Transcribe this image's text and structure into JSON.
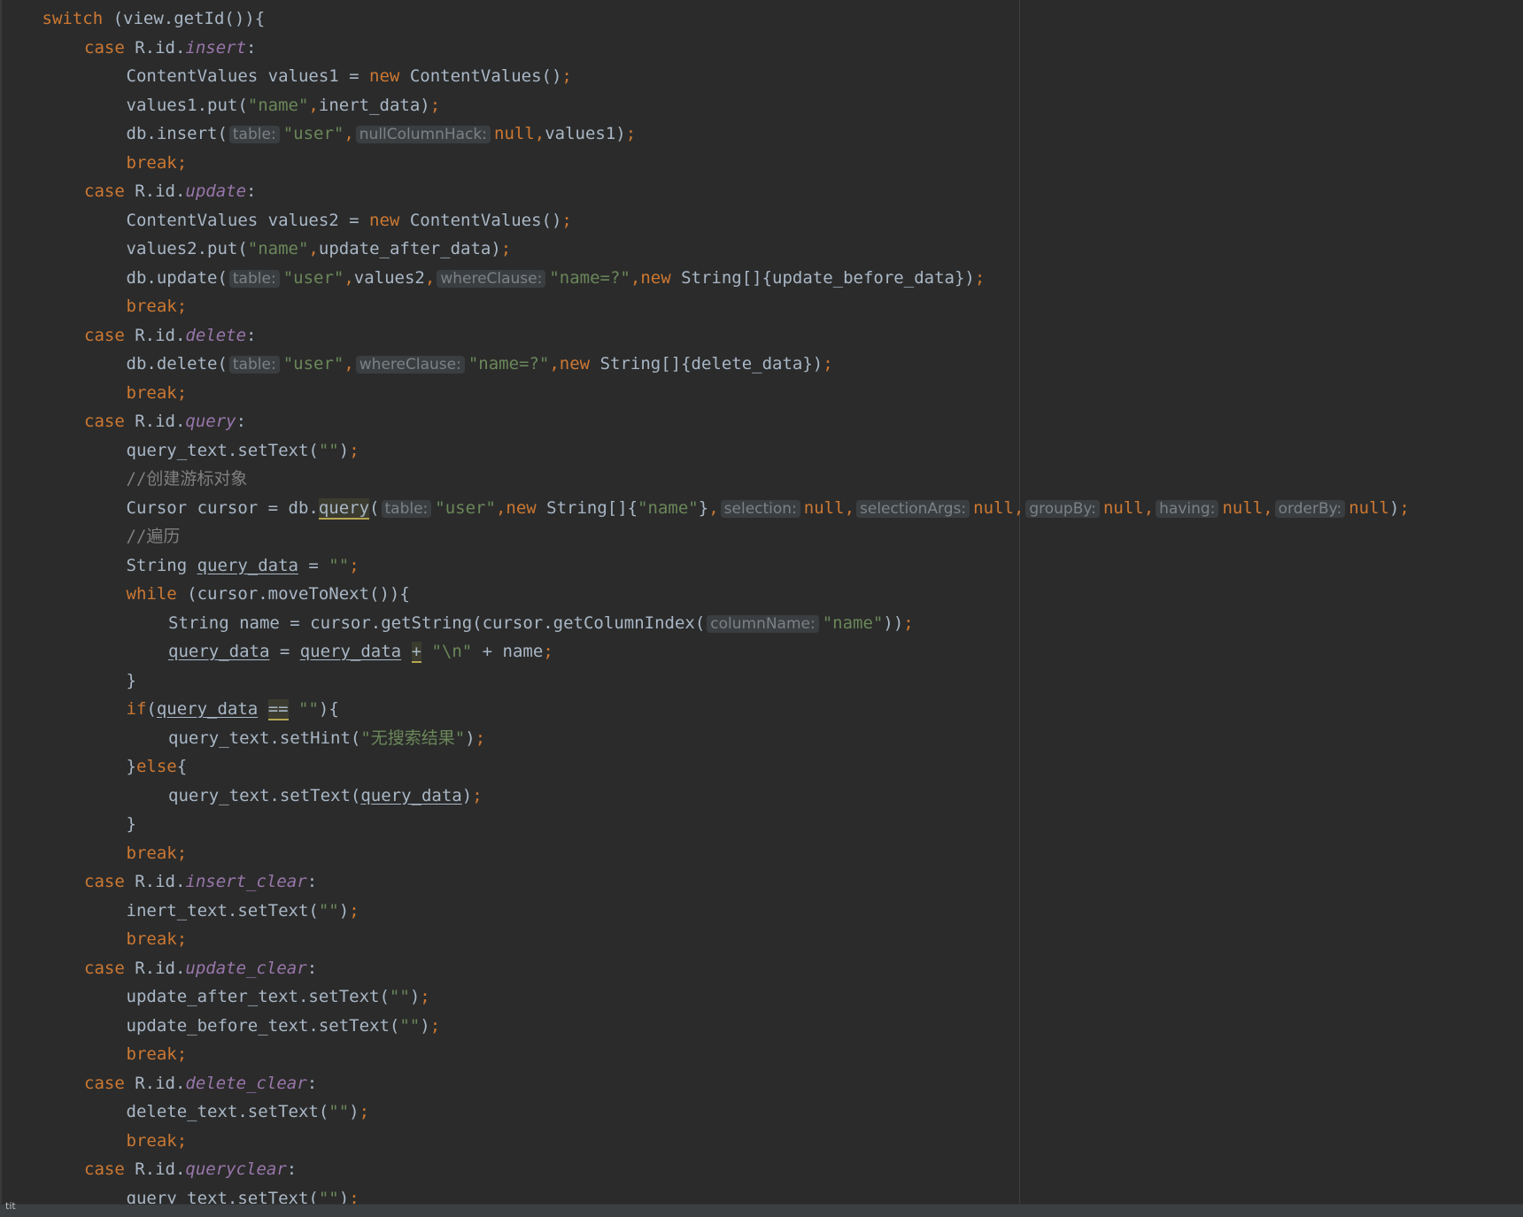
{
  "editor": {
    "language": "java",
    "theme_colors": {
      "background": "#2b2b2b",
      "default_text": "#a9b7c6",
      "keyword": "#cc7832",
      "string": "#6a8759",
      "field": "#9876aa",
      "comment": "#808080",
      "param_hint_bg": "#3b3e40",
      "param_hint_text": "#7b8186"
    },
    "lines": [
      {
        "indent": 1,
        "tokens": [
          {
            "t": "switch",
            "c": "kw"
          },
          {
            "t": " (view.getId()){"
          }
        ]
      },
      {
        "indent": 2,
        "tokens": [
          {
            "t": "case ",
            "c": "kw"
          },
          {
            "t": "R.id."
          },
          {
            "t": "insert",
            "c": "field"
          },
          {
            "t": ":"
          }
        ]
      },
      {
        "indent": 3,
        "tokens": [
          {
            "t": "ContentValues values1 = "
          },
          {
            "t": "new ",
            "c": "kw"
          },
          {
            "t": "ContentValues()"
          },
          {
            "t": ";",
            "c": "kw"
          }
        ]
      },
      {
        "indent": 3,
        "tokens": [
          {
            "t": "values1.put("
          },
          {
            "t": "\"name\"",
            "c": "str"
          },
          {
            "t": ",",
            "c": "kw"
          },
          {
            "t": "inert_data)"
          },
          {
            "t": ";",
            "c": "kw"
          }
        ]
      },
      {
        "indent": 3,
        "tokens": [
          {
            "t": "db.insert("
          },
          {
            "t": "table:",
            "c": "hint"
          },
          {
            "t": "\"user\"",
            "c": "str"
          },
          {
            "t": ",",
            "c": "kw"
          },
          {
            "t": "nullColumnHack:",
            "c": "hint"
          },
          {
            "t": "null",
            "c": "kw"
          },
          {
            "t": ",",
            "c": "kw"
          },
          {
            "t": "values1)"
          },
          {
            "t": ";",
            "c": "kw"
          }
        ]
      },
      {
        "indent": 3,
        "tokens": [
          {
            "t": "break;",
            "c": "kw"
          }
        ]
      },
      {
        "indent": 2,
        "tokens": [
          {
            "t": "case ",
            "c": "kw"
          },
          {
            "t": "R.id."
          },
          {
            "t": "update",
            "c": "field"
          },
          {
            "t": ":"
          }
        ]
      },
      {
        "indent": 3,
        "tokens": [
          {
            "t": "ContentValues values2 = "
          },
          {
            "t": "new ",
            "c": "kw"
          },
          {
            "t": "ContentValues()"
          },
          {
            "t": ";",
            "c": "kw"
          }
        ]
      },
      {
        "indent": 3,
        "tokens": [
          {
            "t": "values2.put("
          },
          {
            "t": "\"name\"",
            "c": "str"
          },
          {
            "t": ",",
            "c": "kw"
          },
          {
            "t": "update_after_data)"
          },
          {
            "t": ";",
            "c": "kw"
          }
        ]
      },
      {
        "indent": 3,
        "tokens": [
          {
            "t": "db.update("
          },
          {
            "t": "table:",
            "c": "hint"
          },
          {
            "t": "\"user\"",
            "c": "str"
          },
          {
            "t": ",",
            "c": "kw"
          },
          {
            "t": "values2"
          },
          {
            "t": ",",
            "c": "kw"
          },
          {
            "t": "whereClause:",
            "c": "hint"
          },
          {
            "t": "\"name=?\"",
            "c": "str"
          },
          {
            "t": ",",
            "c": "kw"
          },
          {
            "t": "new ",
            "c": "kw"
          },
          {
            "t": "String[]{update_before_data})"
          },
          {
            "t": ";",
            "c": "kw"
          }
        ]
      },
      {
        "indent": 3,
        "tokens": [
          {
            "t": "break;",
            "c": "kw"
          }
        ]
      },
      {
        "indent": 2,
        "tokens": [
          {
            "t": "case ",
            "c": "kw"
          },
          {
            "t": "R.id."
          },
          {
            "t": "delete",
            "c": "field"
          },
          {
            "t": ":"
          }
        ]
      },
      {
        "indent": 3,
        "tokens": [
          {
            "t": "db.delete("
          },
          {
            "t": "table:",
            "c": "hint"
          },
          {
            "t": "\"user\"",
            "c": "str"
          },
          {
            "t": ",",
            "c": "kw"
          },
          {
            "t": "whereClause:",
            "c": "hint"
          },
          {
            "t": "\"name=?\"",
            "c": "str"
          },
          {
            "t": ",",
            "c": "kw"
          },
          {
            "t": "new ",
            "c": "kw"
          },
          {
            "t": "String[]{delete_data})"
          },
          {
            "t": ";",
            "c": "kw"
          }
        ]
      },
      {
        "indent": 3,
        "tokens": [
          {
            "t": "break;",
            "c": "kw"
          }
        ]
      },
      {
        "indent": 2,
        "tokens": [
          {
            "t": "case ",
            "c": "kw"
          },
          {
            "t": "R.id."
          },
          {
            "t": "query",
            "c": "field"
          },
          {
            "t": ":"
          }
        ]
      },
      {
        "indent": 3,
        "tokens": [
          {
            "t": "query_text.setText("
          },
          {
            "t": "\"\"",
            "c": "str"
          },
          {
            "t": ")"
          },
          {
            "t": ";",
            "c": "kw"
          }
        ]
      },
      {
        "indent": 3,
        "tokens": [
          {
            "t": "//创建游标对象",
            "c": "cmt"
          }
        ]
      },
      {
        "indent": 3,
        "tokens": [
          {
            "t": "Cursor cursor = db."
          },
          {
            "t": "query",
            "c": "hl"
          },
          {
            "t": "("
          },
          {
            "t": "table:",
            "c": "hint"
          },
          {
            "t": "\"user\"",
            "c": "str"
          },
          {
            "t": ",",
            "c": "kw"
          },
          {
            "t": "new ",
            "c": "kw"
          },
          {
            "t": "String[]{"
          },
          {
            "t": "\"name\"",
            "c": "str"
          },
          {
            "t": "}"
          },
          {
            "t": ",",
            "c": "kw"
          },
          {
            "t": "selection:",
            "c": "hint"
          },
          {
            "t": "null",
            "c": "kw"
          },
          {
            "t": ",",
            "c": "kw"
          },
          {
            "t": "selectionArgs:",
            "c": "hint"
          },
          {
            "t": "null",
            "c": "kw"
          },
          {
            "t": ",",
            "c": "kw"
          },
          {
            "t": "groupBy:",
            "c": "hint"
          },
          {
            "t": "null",
            "c": "kw"
          },
          {
            "t": ",",
            "c": "kw"
          },
          {
            "t": "having:",
            "c": "hint"
          },
          {
            "t": "null",
            "c": "kw"
          },
          {
            "t": ",",
            "c": "kw"
          },
          {
            "t": "orderBy:",
            "c": "hint"
          },
          {
            "t": "null",
            "c": "kw"
          },
          {
            "t": ")"
          },
          {
            "t": ";",
            "c": "kw"
          }
        ]
      },
      {
        "indent": 3,
        "tokens": [
          {
            "t": "//遍历",
            "c": "cmt"
          }
        ]
      },
      {
        "indent": 3,
        "tokens": [
          {
            "t": "String "
          },
          {
            "t": "query_data",
            "c": "u"
          },
          {
            "t": " = "
          },
          {
            "t": "\"\"",
            "c": "str"
          },
          {
            "t": ";",
            "c": "kw"
          }
        ]
      },
      {
        "indent": 3,
        "tokens": [
          {
            "t": "while ",
            "c": "kw"
          },
          {
            "t": "(cursor.moveToNext()){"
          }
        ]
      },
      {
        "indent": 4,
        "tokens": [
          {
            "t": "String name = cursor.getString(cursor.getColumnIndex("
          },
          {
            "t": "columnName:",
            "c": "hint"
          },
          {
            "t": "\"name\"",
            "c": "str"
          },
          {
            "t": "))"
          },
          {
            "t": ";",
            "c": "kw"
          }
        ]
      },
      {
        "indent": 4,
        "tokens": [
          {
            "t": "query_data",
            "c": "u"
          },
          {
            "t": " = "
          },
          {
            "t": "query_data",
            "c": "u"
          },
          {
            "t": " "
          },
          {
            "t": "+",
            "c": "hl"
          },
          {
            "t": " "
          },
          {
            "t": "\"\\n\"",
            "c": "str"
          },
          {
            "t": " + name"
          },
          {
            "t": ";",
            "c": "kw"
          }
        ]
      },
      {
        "indent": 3,
        "tokens": [
          {
            "t": "}"
          }
        ]
      },
      {
        "indent": 3,
        "tokens": [
          {
            "t": "if",
            "c": "kw"
          },
          {
            "t": "("
          },
          {
            "t": "query_data",
            "c": "u"
          },
          {
            "t": " "
          },
          {
            "t": "==",
            "c": "hl"
          },
          {
            "t": " "
          },
          {
            "t": "\"\"",
            "c": "str"
          },
          {
            "t": "){"
          }
        ]
      },
      {
        "indent": 4,
        "tokens": [
          {
            "t": "query_text.setHint("
          },
          {
            "t": "\"无搜索结果\"",
            "c": "str"
          },
          {
            "t": ")"
          },
          {
            "t": ";",
            "c": "kw"
          }
        ]
      },
      {
        "indent": 3,
        "tokens": [
          {
            "t": "}"
          },
          {
            "t": "else",
            "c": "kw"
          },
          {
            "t": "{"
          }
        ]
      },
      {
        "indent": 4,
        "tokens": [
          {
            "t": "query_text.setText("
          },
          {
            "t": "query_data",
            "c": "u"
          },
          {
            "t": ")"
          },
          {
            "t": ";",
            "c": "kw"
          }
        ]
      },
      {
        "indent": 3,
        "tokens": [
          {
            "t": "}"
          }
        ]
      },
      {
        "indent": 3,
        "tokens": [
          {
            "t": "break;",
            "c": "kw"
          }
        ]
      },
      {
        "indent": 2,
        "tokens": [
          {
            "t": "case ",
            "c": "kw"
          },
          {
            "t": "R.id."
          },
          {
            "t": "insert_clear",
            "c": "field"
          },
          {
            "t": ":"
          }
        ]
      },
      {
        "indent": 3,
        "tokens": [
          {
            "t": "inert_text.setText("
          },
          {
            "t": "\"\"",
            "c": "str"
          },
          {
            "t": ")"
          },
          {
            "t": ";",
            "c": "kw"
          }
        ]
      },
      {
        "indent": 3,
        "tokens": [
          {
            "t": "break;",
            "c": "kw"
          }
        ]
      },
      {
        "indent": 2,
        "tokens": [
          {
            "t": "case ",
            "c": "kw"
          },
          {
            "t": "R.id."
          },
          {
            "t": "update_clear",
            "c": "field"
          },
          {
            "t": ":"
          }
        ]
      },
      {
        "indent": 3,
        "tokens": [
          {
            "t": "update_after_text.setText("
          },
          {
            "t": "\"\"",
            "c": "str"
          },
          {
            "t": ")"
          },
          {
            "t": ";",
            "c": "kw"
          }
        ]
      },
      {
        "indent": 3,
        "tokens": [
          {
            "t": "update_before_text.setText("
          },
          {
            "t": "\"\"",
            "c": "str"
          },
          {
            "t": ")"
          },
          {
            "t": ";",
            "c": "kw"
          }
        ]
      },
      {
        "indent": 3,
        "tokens": [
          {
            "t": "break;",
            "c": "kw"
          }
        ]
      },
      {
        "indent": 2,
        "tokens": [
          {
            "t": "case ",
            "c": "kw"
          },
          {
            "t": "R.id."
          },
          {
            "t": "delete_clear",
            "c": "field"
          },
          {
            "t": ":"
          }
        ]
      },
      {
        "indent": 3,
        "tokens": [
          {
            "t": "delete_text.setText("
          },
          {
            "t": "\"\"",
            "c": "str"
          },
          {
            "t": ")"
          },
          {
            "t": ";",
            "c": "kw"
          }
        ]
      },
      {
        "indent": 3,
        "tokens": [
          {
            "t": "break;",
            "c": "kw"
          }
        ]
      },
      {
        "indent": 2,
        "tokens": [
          {
            "t": "case ",
            "c": "kw"
          },
          {
            "t": "R.id."
          },
          {
            "t": "queryclear",
            "c": "field"
          },
          {
            "t": ":"
          }
        ]
      },
      {
        "indent": 3,
        "tokens": [
          {
            "t": "query_text.setText("
          },
          {
            "t": "\"\"",
            "c": "str"
          },
          {
            "t": ")"
          },
          {
            "t": ";",
            "c": "kw"
          }
        ]
      }
    ]
  },
  "status_bar": {
    "text": "tit"
  }
}
